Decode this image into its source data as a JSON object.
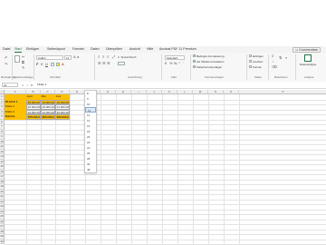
{
  "menu": {
    "tabs": [
      "Datei",
      "Start",
      "Einfügen",
      "Seitenlayout",
      "Formeln",
      "Daten",
      "Überprüfen",
      "Ansicht",
      "Hilfe",
      "Acrobat PDF 11 Premium"
    ],
    "active": "Start",
    "comments_label": "Kommentare"
  },
  "ribbon": {
    "font_name": "Calibri",
    "font_size": "11",
    "number_format": "Standard",
    "groups": [
      "Rückgängig",
      "Zwischenablage",
      "Schriftart",
      "Ausrichtung",
      "Zahl",
      "Formatvorlagen",
      "Zellen",
      "Bearbeiten",
      "Analyse"
    ],
    "styles_items": [
      "Bedingte Formatierung",
      "Als Tabelle formatieren",
      "Zellenformatvorlagen"
    ],
    "cells_items": [
      "Einfügen",
      "Löschen",
      "Format"
    ],
    "analyse_label": "Datenanalyse",
    "wrap_label": "Textumbruch"
  },
  "formula_bar": {
    "cell_ref": "A1",
    "fx": "fx",
    "content": "Filiale 1"
  },
  "grid": {
    "columns": [
      "A",
      "B",
      "C",
      "D",
      "E",
      "F",
      "G",
      "H",
      "I",
      "J",
      "K",
      "L",
      "M",
      "N",
      "O",
      "P"
    ],
    "rows": [
      "1",
      "2",
      "3",
      "4",
      "5",
      "6",
      "7",
      "8",
      "9",
      "10",
      "11",
      "12",
      "13",
      "14",
      "15",
      "16",
      "17",
      "18",
      "19",
      "20",
      "21",
      "22",
      "23",
      "24",
      "25",
      "26",
      "27",
      "28",
      "29",
      "30"
    ],
    "headers": [
      "April",
      "Mai",
      "Juni"
    ],
    "data_rows": [
      {
        "label": "FILIALE 1",
        "values": [
          "25.000,00 €",
          "23.000,00 €",
          "26.000,00 €"
        ]
      },
      {
        "label": "Filiale 2",
        "values": [
          "26.000,00 €",
          "29.000,00 €",
          "31.000,00 €"
        ]
      },
      {
        "label": "Filiale 3",
        "values": [
          "24.000,00 €",
          "24.000,00 €",
          "26.000,00 €"
        ]
      }
    ],
    "total_row": {
      "label": "Summe",
      "values": [
        "755.000,00 €",
        "850.000,00 €",
        "800.000,00 €"
      ]
    }
  },
  "font_size_dropdown": {
    "options": [
      "8",
      "9",
      "10",
      "11",
      "12",
      "14",
      "16",
      "18",
      "20",
      "22",
      "24",
      "26",
      "28",
      "36",
      "48"
    ],
    "selected": "11"
  },
  "colors": {
    "accent_green": "#1e7145",
    "highlight_yellow": "#ffc000"
  }
}
